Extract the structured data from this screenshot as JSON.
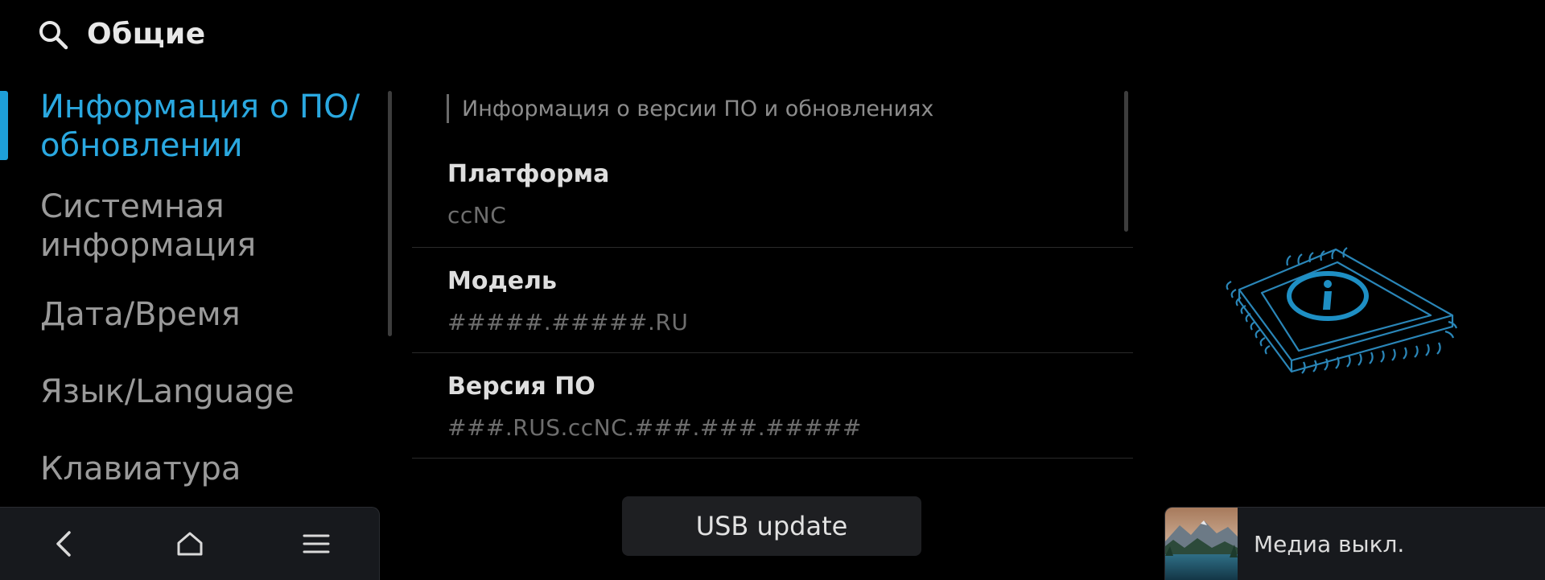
{
  "header": {
    "title": "Общие",
    "icon": "search-icon"
  },
  "menu": {
    "items": [
      {
        "label_line1": "Информация о ПО/",
        "label_line2": "обновлении",
        "active": true
      },
      {
        "label_line1": "Системная",
        "label_line2": "информация",
        "active": false
      },
      {
        "label_line1": "Дата/Время",
        "active": false
      },
      {
        "label_line1": "Язык/Language",
        "active": false
      },
      {
        "label_line1": "Клавиатура",
        "active": false
      }
    ]
  },
  "content": {
    "section_title": "Информация о версии ПО и обновлениях",
    "rows": [
      {
        "label": "Платформа",
        "value": "ccNC"
      },
      {
        "label": "Модель",
        "value": "#####.#####.RU"
      },
      {
        "label": "Версия ПО",
        "value": "###.RUS.ccNC.###.###.#####"
      }
    ],
    "usb_button": "USB update"
  },
  "illustration": {
    "icon": "chip-info-icon",
    "accent_color": "#1e8fc4"
  },
  "nav": {
    "back_icon": "back-icon",
    "home_icon": "home-icon",
    "menu_icon": "menu-icon"
  },
  "media": {
    "status": "Медиа выкл."
  },
  "colors": {
    "accent": "#2aa8e0",
    "background": "#000000",
    "panel": "#17191d"
  }
}
